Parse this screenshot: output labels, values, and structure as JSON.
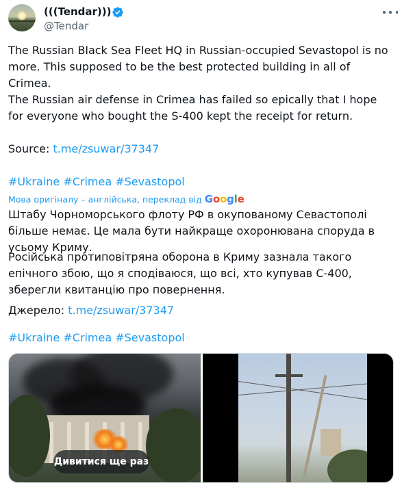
{
  "author": {
    "display_name": "(((Tendar)))",
    "handle": "@Tendar",
    "verified": true,
    "avatar_icon": "sunrise-field-avatar"
  },
  "tweet": {
    "paragraph_1": "The Russian Black Sea Fleet HQ in Russian-occupied Sevastopol is no more. This supposed to be the best protected building in all of Crimea.",
    "paragraph_2": "The Russian air defense in Crimea has failed so epically that I hope for everyone who bought the S-400 kept the receipt for return.",
    "source_label": "Source: ",
    "source_link": "t.me/zsuwar/37347",
    "hashtags": [
      "#Ukraine",
      "#Crimea",
      "#Sevastopol"
    ]
  },
  "translation": {
    "notice": "Мова оригіналу – англійська, переклад від ",
    "provider": "Google",
    "paragraph_1": "Штабу Чорноморського флоту РФ в окупованому Севастополі більше немає. Це мала бути найкраще охоронювана споруда в усьому Криму.",
    "paragraph_2": "Російська протиповітряна оборона в Криму зазнала такого епічного збою, що я сподіваюся, що всі, хто купував С-400, зберегли квитанцію про повернення.",
    "source_label": "Джерело: ",
    "source_link": "t.me/zsuwar/37347",
    "hashtags": [
      "#Ukraine",
      "#Crimea",
      "#Sevastopol"
    ]
  },
  "media": {
    "replay_label": "Дивитися ще раз"
  },
  "colors": {
    "link": "#1d9bf0",
    "text": "#0f1419",
    "secondary": "#536471"
  }
}
